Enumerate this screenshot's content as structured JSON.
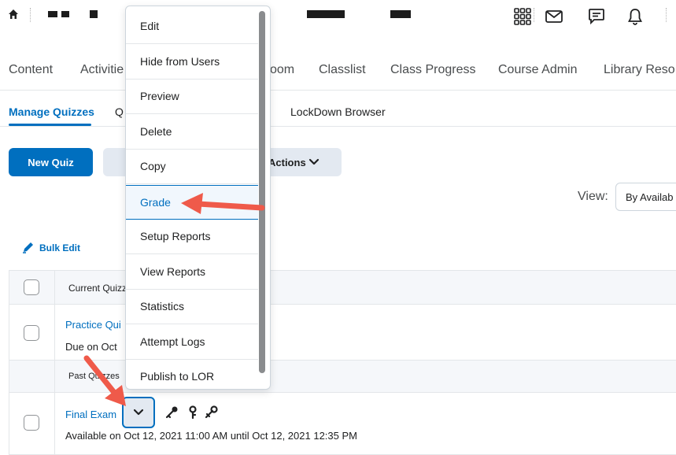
{
  "topbar": {
    "icons": [
      "home-icon",
      "waffle-grid-icon",
      "mail-icon",
      "chat-icon",
      "bell-icon"
    ]
  },
  "nav": {
    "items": [
      "Content",
      "Activitie",
      "oom",
      "Classlist",
      "Class Progress",
      "Course Admin",
      "Library Reso"
    ]
  },
  "tabs": {
    "manage": "Manage Quizzes",
    "q": "Q",
    "lockdown": "LockDown Browser"
  },
  "toolbar": {
    "new_quiz": "New Quiz",
    "actions": "Actions",
    "view_label": "View:",
    "view_value": "By Availab",
    "bulk_edit": "Bulk Edit"
  },
  "table": {
    "current_header": "Current Quizz",
    "practice_title": "Practice Qui",
    "practice_due": "Due on Oct",
    "past_header": "Past Quizzes",
    "final_title": "Final Exam",
    "final_availability": "Available on Oct 12, 2021 11:00 AM until Oct 12, 2021 12:35 PM"
  },
  "menu": {
    "items": [
      "Edit",
      "Hide from Users",
      "Preview",
      "Delete",
      "Copy",
      "Grade",
      "Setup Reports",
      "View Reports",
      "Statistics",
      "Attempt Logs",
      "Publish to LOR"
    ],
    "highlighted": "Grade"
  },
  "colors": {
    "accent": "#006fbf",
    "arrow": "#ef5a4a"
  }
}
